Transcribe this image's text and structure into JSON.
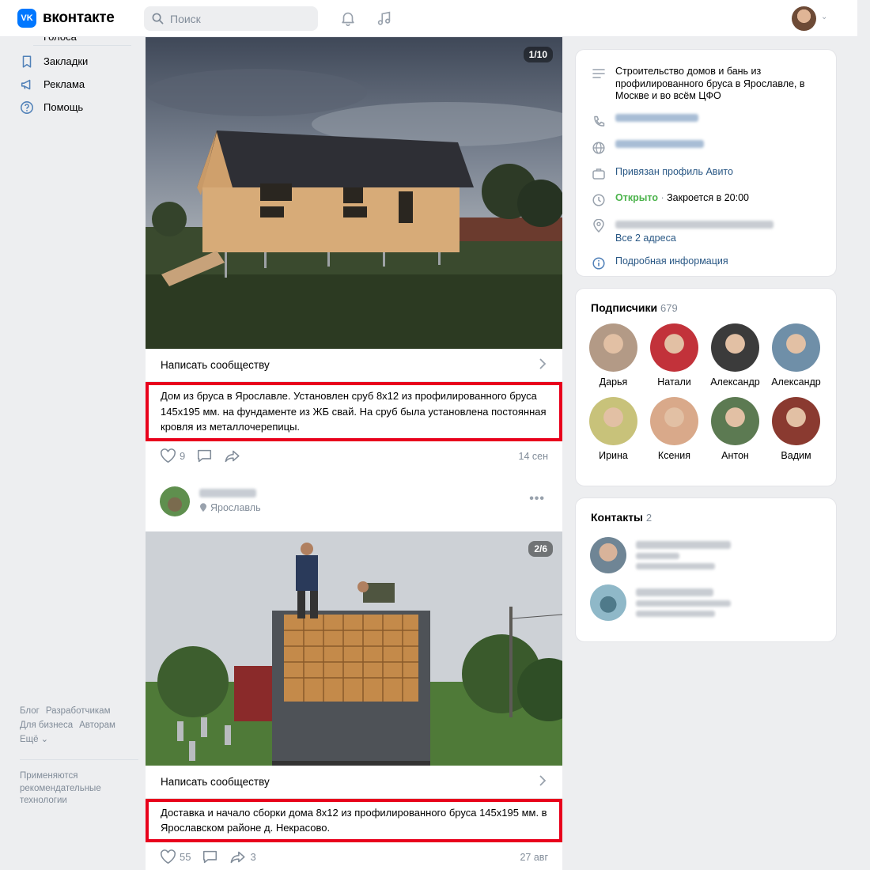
{
  "header": {
    "logo_text": "вконтакте",
    "logo_badge": "VK",
    "search_placeholder": "Поиск"
  },
  "left_nav": {
    "items": [
      {
        "label": "Голоса"
      },
      {
        "label": "Закладки"
      },
      {
        "label": "Реклама"
      },
      {
        "label": "Помощь"
      }
    ],
    "footer_links": [
      "Блог",
      "Разработчикам",
      "Для бизнеса",
      "Авторам",
      "Ещё"
    ],
    "footer_note": "Применяются рекомендательные технологии"
  },
  "posts": [
    {
      "photo_counter": "1/10",
      "write_label": "Написать сообществу",
      "text": "Дом из бруса в Ярославле. Установлен сруб 8х12 из профилированного бруса 145х195 мм. на фундаменте из ЖБ свай. На сруб была установлена постоянная кровля из металлочерепицы.",
      "likes": "9",
      "comments": "",
      "shares": "",
      "date": "14 сен"
    },
    {
      "author_location": "Ярославль",
      "photo_counter": "2/6",
      "write_label": "Написать сообществу",
      "text": "Доставка и начало сборки дома 8х12 из профилированного бруса 145х195 мм. в Ярославском районе д. Некрасово.",
      "likes": "55",
      "comments": "",
      "shares": "3",
      "date": "27 авг"
    }
  ],
  "info": {
    "description": "Строительство домов и бань из профилированного бруса в Ярославле, в Москве и во всём ЦФО",
    "avito": "Привязан профиль Авито",
    "open_status": "Открыто",
    "open_closes": "Закроется в 20:00",
    "addresses": "Все 2 адреса",
    "more_info": "Подробная информация"
  },
  "subscribers": {
    "title": "Подписчики",
    "count": "679",
    "people": [
      {
        "name": "Дарья",
        "color": "#b39a86"
      },
      {
        "name": "Натали",
        "color": "#c2323a"
      },
      {
        "name": "Александр",
        "color": "#3b3b3b"
      },
      {
        "name": "Александр",
        "color": "#6f8fa8"
      },
      {
        "name": "Ирина",
        "color": "#c8c27a"
      },
      {
        "name": "Ксения",
        "color": "#d9a98a"
      },
      {
        "name": "Антон",
        "color": "#5c7a52"
      },
      {
        "name": "Вадим",
        "color": "#8a3a30"
      }
    ]
  },
  "contacts": {
    "title": "Контакты",
    "count": "2"
  },
  "colors": {
    "accent": "#0077ff",
    "link": "#2a5885",
    "highlight_border": "#e8001c",
    "open_green": "#4bb34b"
  }
}
